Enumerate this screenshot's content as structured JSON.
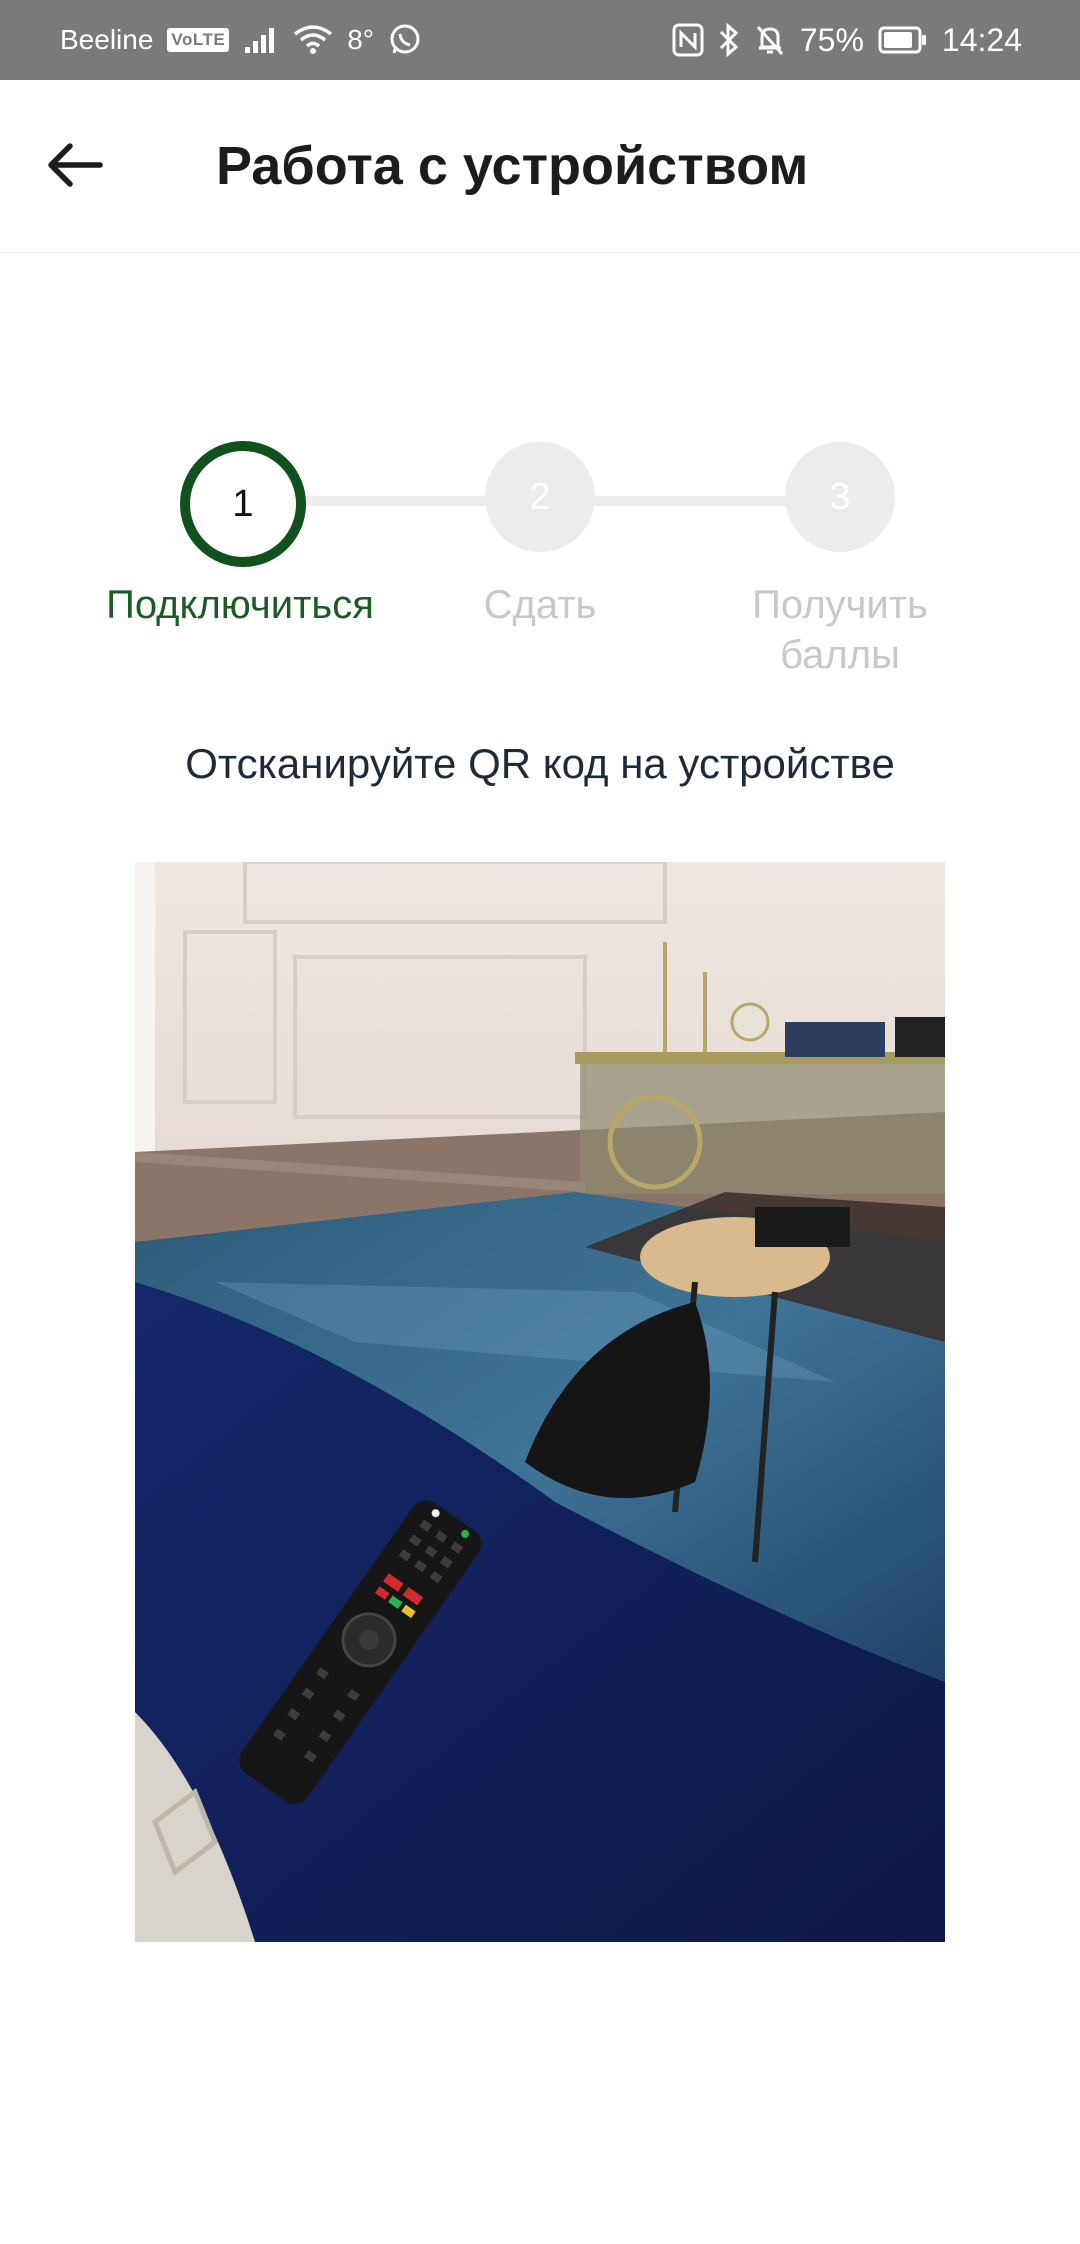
{
  "status_bar": {
    "carrier": "Beeline",
    "volte": "VoLTE",
    "temperature": "8°",
    "battery": "75%",
    "time": "14:24",
    "icons": [
      "signal-icon",
      "wifi-icon",
      "whatsapp-icon",
      "nfc-icon",
      "bluetooth-icon",
      "mute-bell-icon",
      "battery-icon"
    ]
  },
  "header": {
    "title": "Работа с устройством",
    "back_icon": "arrow-left-icon"
  },
  "stepper": {
    "steps": [
      {
        "number": "1",
        "label": "Подключиться",
        "active": true
      },
      {
        "number": "2",
        "label": "Сдать",
        "active": false
      },
      {
        "number": "3",
        "label": "Получить баллы",
        "active": false
      }
    ],
    "active_color": "#11511d",
    "inactive_color": "#ececea"
  },
  "main": {
    "instruction": "Отсканируйте QR код на устройстве",
    "camera_view": "camera-preview"
  }
}
